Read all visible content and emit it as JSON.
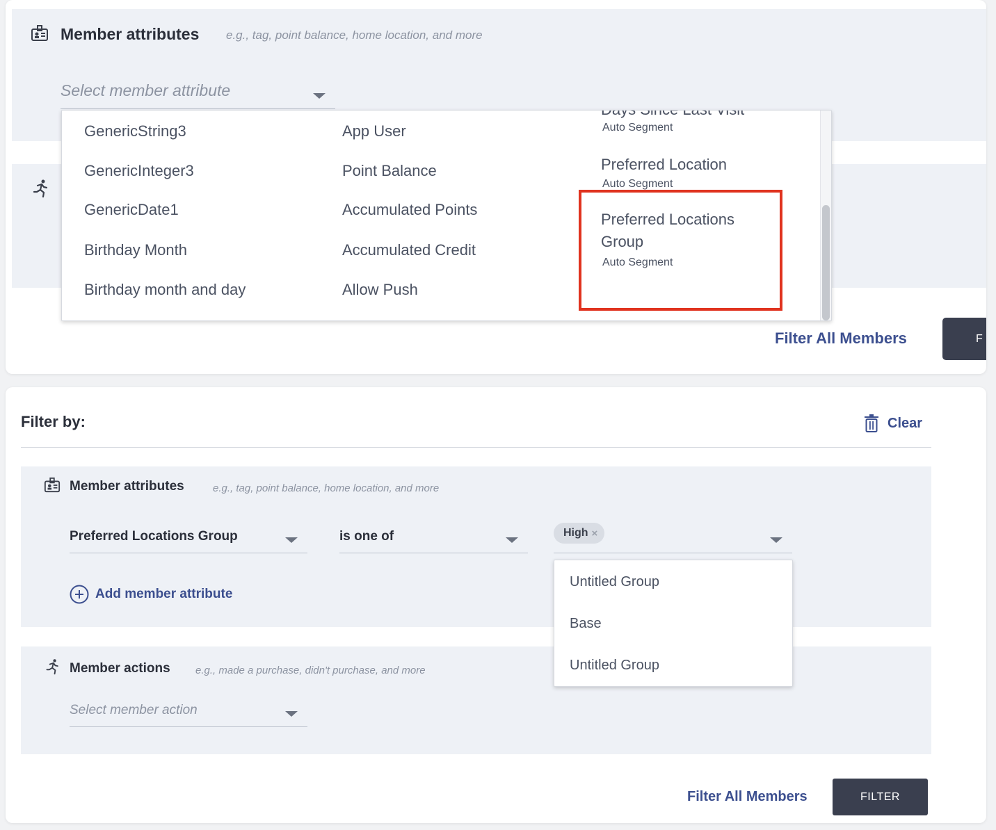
{
  "top": {
    "member_attributes": {
      "title": "Member attributes",
      "hint": "e.g., tag, point balance, home location, and more",
      "placeholder": "Select member attribute"
    },
    "dropdown": {
      "col1": [
        "GenericString3",
        "GenericInteger3",
        "GenericDate1",
        "Birthday Month",
        "Birthday month and day"
      ],
      "col2": [
        "App User",
        "Point Balance",
        "Accumulated Points",
        "Accumulated Credit",
        "Allow Push"
      ],
      "col3": {
        "cut_item": "Days Since Last Visit",
        "cut_sub": "Auto Segment",
        "item2": "Preferred Location",
        "item2_sub": "Auto Segment",
        "item3_line1": "Preferred Locations",
        "item3_line2": "Group",
        "item3_sub": "Auto Segment"
      }
    },
    "filter_all_label": "Filter All Members",
    "filter_btn_label": "F"
  },
  "bottom": {
    "filter_by_label": "Filter by:",
    "clear_label": "Clear",
    "member_attributes": {
      "title": "Member attributes",
      "hint": "e.g., tag, point balance, home location, and more",
      "attribute_value": "Preferred Locations Group",
      "operator_value": "is one of",
      "chip_label": "High",
      "chip_remove": "×",
      "add_label": "Add member attribute"
    },
    "options": [
      "Untitled Group",
      "Base",
      "Untitled Group"
    ],
    "member_actions": {
      "title": "Member actions",
      "hint": "e.g., made a purchase, didn't purchase, and more",
      "placeholder": "Select member action"
    },
    "filter_all_label": "Filter All Members",
    "filter_btn_label": "FILTER"
  },
  "colors": {
    "accent": "#3c4f8f",
    "highlight_box": "#e0331f",
    "panel_bg": "#eef1f6",
    "button_dark": "#3a3f4f"
  }
}
